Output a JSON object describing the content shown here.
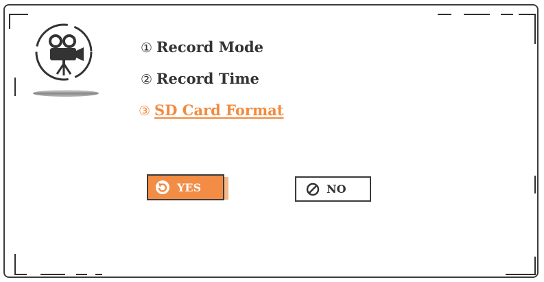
{
  "menu": {
    "items": [
      {
        "num": "①",
        "label": "Record Mode"
      },
      {
        "num": "②",
        "label": "Record Time"
      },
      {
        "num": "③",
        "label": "SD Card Format"
      }
    ],
    "active_index": 2
  },
  "dialog": {
    "yes_label": "YES",
    "no_label": "NO"
  },
  "icons": {
    "mode_icon": "video-camera-icon",
    "yes_icon": "refresh-icon",
    "no_icon": "cancel-icon"
  },
  "colors": {
    "accent": "#f28a3d",
    "text": "#333333",
    "frame": "#3b3b3b"
  }
}
